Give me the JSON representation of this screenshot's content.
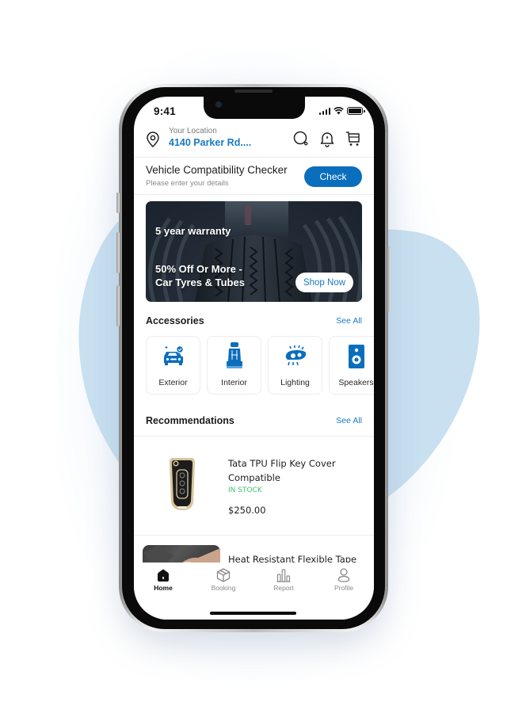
{
  "status_bar": {
    "time": "9:41"
  },
  "header": {
    "location_label": "Your Location",
    "location_value": "4140 Parker Rd....",
    "icons": [
      "location-pin-icon",
      "search-icon",
      "bell-icon",
      "cart-icon"
    ]
  },
  "checker": {
    "title": "Vehicle Compatibility Checker",
    "subtitle": "Please enter your details",
    "button_label": "Check"
  },
  "banner": {
    "headline": "5 year warranty",
    "offer_line1": "50% Off Or More -",
    "offer_line2": "Car Tyres & Tubes",
    "button_label": "Shop Now"
  },
  "accessories": {
    "title": "Accessories",
    "see_all": "See All",
    "items": [
      {
        "label": "Exterior",
        "icon": "car-exterior-icon"
      },
      {
        "label": "Interior",
        "icon": "car-seat-icon"
      },
      {
        "label": "Lighting",
        "icon": "headlight-icon"
      },
      {
        "label": "Speakers",
        "icon": "speaker-icon"
      }
    ]
  },
  "recommendations": {
    "title": "Recommendations",
    "see_all": "See All",
    "products": [
      {
        "name": "Tata TPU Flip Key Cover Compatible",
        "stock": "IN STOCK",
        "price": "$250.00"
      },
      {
        "name": "Heat Resistant Flexible Tape"
      }
    ]
  },
  "bottom_nav": {
    "items": [
      {
        "label": "Home",
        "icon": "home-icon",
        "active": true
      },
      {
        "label": "Booking",
        "icon": "package-icon",
        "active": false
      },
      {
        "label": "Report",
        "icon": "bar-chart-icon",
        "active": false
      },
      {
        "label": "Profile",
        "icon": "user-icon",
        "active": false
      }
    ]
  },
  "colors": {
    "accent": "#0A6EBD",
    "link": "#1A79C2",
    "in_stock": "#3CC26A",
    "blob": "#C8E0F0"
  }
}
